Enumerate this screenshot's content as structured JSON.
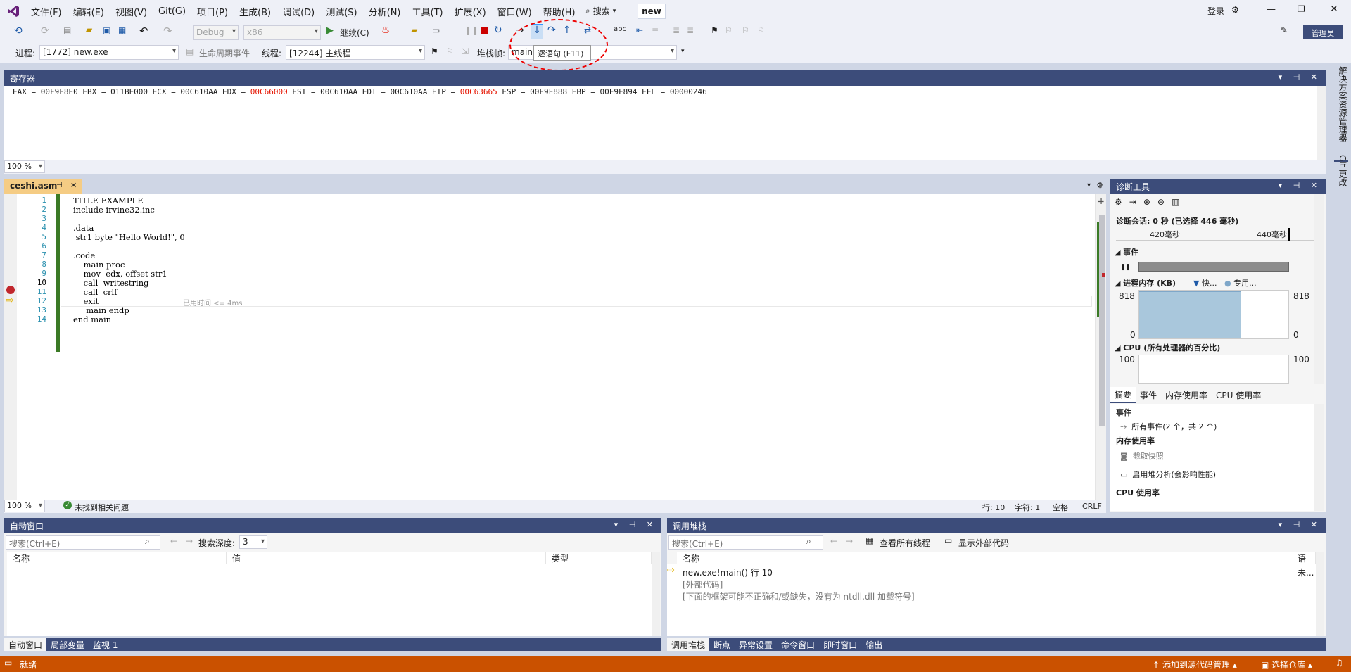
{
  "menu": [
    "文件(F)",
    "编辑(E)",
    "视图(V)",
    "Git(G)",
    "项目(P)",
    "生成(B)",
    "调试(D)",
    "测试(S)",
    "分析(N)",
    "工具(T)",
    "扩展(X)",
    "窗口(W)",
    "帮助(H)"
  ],
  "search_label": "搜索",
  "solution_badge": "new",
  "login_label": "登录",
  "admin_label": "管理员",
  "toolbar": {
    "config": "Debug",
    "platform": "x86",
    "continue_label": "继续(C)",
    "process_label": "进程:",
    "process_value": "[1772] new.exe",
    "lifecycle_label": "生命周期事件",
    "thread_label": "线程:",
    "thread_value": "[12244] 主线程",
    "stackframe_label": "堆栈帧:",
    "stackframe_value": "main",
    "tooltip": "逐语句 (F11)"
  },
  "registers": {
    "title": "寄存器",
    "parts": [
      {
        "text": "EAX = 00F9F8E0 EBX = 011BE000 ECX = 00C610AA EDX = ",
        "red": false
      },
      {
        "text": "00C66000",
        "red": true
      },
      {
        "text": " ESI = 00C610AA EDI = 00C610AA EIP = ",
        "red": false
      },
      {
        "text": "00C63665",
        "red": true
      },
      {
        "text": " ESP = 00F9F888 EBP = 00F9F894 EFL = 00000246",
        "red": false
      }
    ],
    "zoom": "100 %"
  },
  "editor": {
    "tab": "ceshi.asm",
    "lines": [
      {
        "n": "1",
        "code": "TITLE EXAMPLE"
      },
      {
        "n": "2",
        "code": "include irvine32.inc"
      },
      {
        "n": "3",
        "code": ""
      },
      {
        "n": "4",
        "code": ".data"
      },
      {
        "n": "5",
        "code": " str1 byte \"Hello World!\", 0"
      },
      {
        "n": "6",
        "code": ""
      },
      {
        "n": "7",
        "code": ".code"
      },
      {
        "n": "8",
        "code": "    main proc"
      },
      {
        "n": "9",
        "code": "    mov  edx, offset str1"
      },
      {
        "n": "10",
        "code": "    call  writestring"
      },
      {
        "n": "11",
        "code": "    call  crlf"
      },
      {
        "n": "12",
        "code": "    exit"
      },
      {
        "n": "13",
        "code": "     main endp"
      },
      {
        "n": "14",
        "code": "end main"
      }
    ],
    "elapsed": "已用时间 <= 4ms",
    "zoom": "100 %",
    "issues": "未找到相关问题",
    "row": "行: 10",
    "col": "字符: 1",
    "ws": "空格",
    "eol": "CRLF"
  },
  "diagnostics": {
    "title": "诊断工具",
    "session": "诊断会话: 0 秒 (已选择 446 毫秒)",
    "tick1": "420毫秒",
    "tick2": "440毫秒",
    "events": "事件",
    "memory": "进程内存 (KB)",
    "mem_legend1": "快...",
    "mem_legend2": "专用...",
    "mem_max": "818",
    "mem_min": "0",
    "cpu": "CPU (所有处理器的百分比)",
    "cpu_max": "100",
    "tabs": [
      "摘要",
      "事件",
      "内存使用率",
      "CPU 使用率"
    ],
    "sec_events": "事件",
    "all_events": "所有事件(2 个，共 2 个)",
    "sec_memory": "内存使用率",
    "snapshot": "截取快照",
    "heap": "启用堆分析(会影响性能)",
    "sec_cpu": "CPU 使用率",
    "memory_fill": 0.98
  },
  "autos": {
    "title": "自动窗口",
    "search_placeholder": "搜索(Ctrl+E)",
    "depth_label": "搜索深度:",
    "depth": "3",
    "cols": [
      "名称",
      "值",
      "类型"
    ],
    "tabs": [
      "自动窗口",
      "局部变量",
      "监视 1"
    ]
  },
  "callstack": {
    "title": "调用堆栈",
    "search_placeholder": "搜索(Ctrl+E)",
    "view_threads": "查看所有线程",
    "show_external": "显示外部代码",
    "cols": [
      "名称",
      "语言"
    ],
    "rows": [
      {
        "name": "new.exe!main() 行 10",
        "lang": "未..."
      },
      {
        "name": "[外部代码]",
        "lang": ""
      },
      {
        "name": "[下面的框架可能不正确和/或缺失，没有为 ntdll.dll 加载符号]",
        "lang": ""
      }
    ],
    "tabs": [
      "调用堆栈",
      "断点",
      "异常设置",
      "命令窗口",
      "即时窗口",
      "输出"
    ]
  },
  "status": {
    "ready": "就绪",
    "source_control": "添加到源代码管理",
    "repo": "选择仓库"
  },
  "sidebar": [
    "解决方案资源管理器",
    "Git 更改"
  ]
}
